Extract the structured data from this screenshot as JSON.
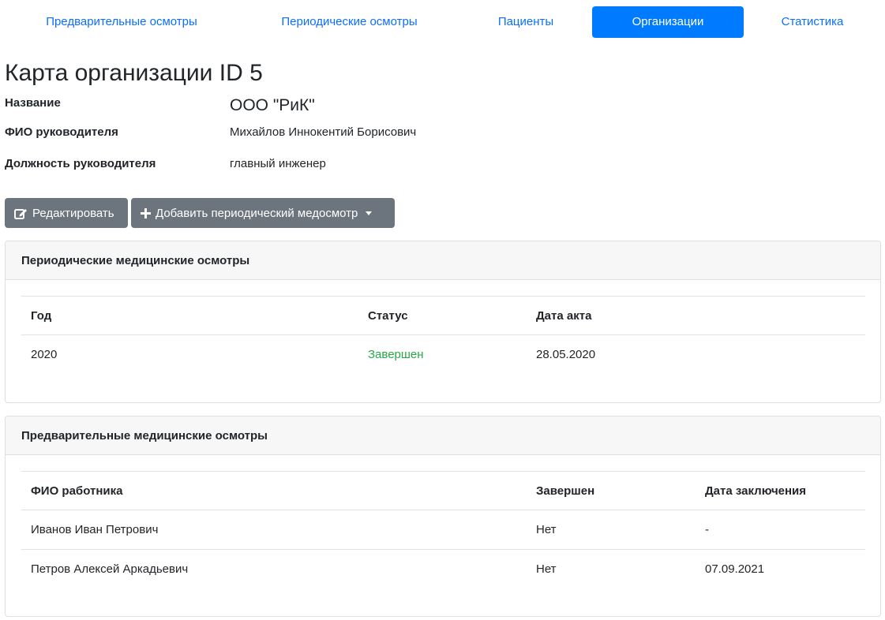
{
  "nav": {
    "items": [
      {
        "label": "Предварительные осмотры"
      },
      {
        "label": "Периодические осмотры"
      },
      {
        "label": "Пациенты"
      },
      {
        "label": "Организации",
        "active": true
      },
      {
        "label": "Статистика"
      }
    ],
    "active_color": "#007bff"
  },
  "page": {
    "title": "Карта организации ID 5"
  },
  "org": {
    "name_label": "Название",
    "name_value": "ООО \"РиК\"",
    "head_label": "ФИО руководителя",
    "head_value": "Михайлов Иннокентий Борисович",
    "position_label": "Должность руководителя",
    "position_value": "главный инженер"
  },
  "actions": {
    "edit_label": "Редактировать",
    "edit_icon": "edit-icon",
    "add_label": "Добавить периодический медосмотр",
    "add_icon": "plus-icon",
    "button_color": "#6c757d"
  },
  "periodic": {
    "header": "Периодические медицинские осмотры",
    "columns": [
      "Год",
      "Статус",
      "Дата акта"
    ],
    "rows": [
      {
        "year": "2020",
        "status": "Завершен",
        "date": "28.05.2020"
      }
    ],
    "status_color": "#28a745"
  },
  "preliminary": {
    "header": "Предварительные медицинские осмотры",
    "columns": [
      "ФИО работника",
      "Завершен",
      "Дата заключения"
    ],
    "rows": [
      {
        "name": "Иванов Иван Петрович",
        "done": "Нет",
        "date": "-"
      },
      {
        "name": "Петров Алексей Аркадьевич",
        "done": "Нет",
        "date": "07.09.2021"
      }
    ]
  }
}
